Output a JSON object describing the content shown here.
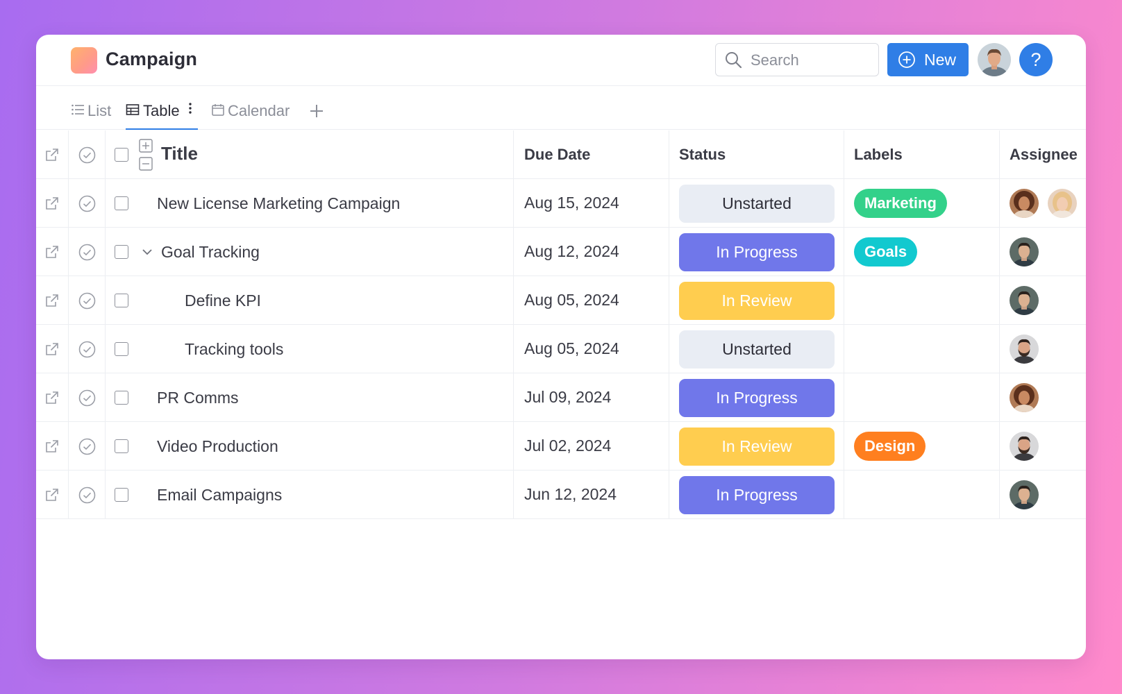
{
  "app": {
    "title": "Campaign"
  },
  "header": {
    "search": {
      "placeholder": "Search"
    },
    "new_button_label": "New",
    "help_label": "?"
  },
  "tabs": [
    {
      "label": "List",
      "icon": "list-icon",
      "active": false
    },
    {
      "label": "Table",
      "icon": "table-icon",
      "active": true
    },
    {
      "label": "Calendar",
      "icon": "calendar-icon",
      "active": false
    }
  ],
  "table": {
    "columns": {
      "title": "Title",
      "due_date": "Due Date",
      "status": "Status",
      "labels": "Labels",
      "assignee": "Assignee"
    },
    "rows": [
      {
        "title": "New License Marketing Campaign",
        "due": "Aug 15, 2024",
        "status": "Unstarted",
        "label": "Marketing",
        "assignees": [
          "woman-curly-hair",
          "woman-blonde"
        ],
        "indent": 0,
        "expandable": false
      },
      {
        "title": "Goal Tracking",
        "due": "Aug 12, 2024",
        "status": "In Progress",
        "label": "Goals",
        "assignees": [
          "man-short-hair"
        ],
        "indent": 0,
        "expandable": true
      },
      {
        "title": "Define KPI",
        "due": "Aug 05, 2024",
        "status": "In Review",
        "label": "",
        "assignees": [
          "man-short-hair"
        ],
        "indent": 1,
        "expandable": false
      },
      {
        "title": "Tracking tools",
        "due": "Aug 05, 2024",
        "status": "Unstarted",
        "label": "",
        "assignees": [
          "man-beard"
        ],
        "indent": 1,
        "expandable": false
      },
      {
        "title": "PR Comms",
        "due": "Jul 09, 2024",
        "status": "In Progress",
        "label": "",
        "assignees": [
          "woman-curly-hair"
        ],
        "indent": 0,
        "expandable": false
      },
      {
        "title": "Video Production",
        "due": "Jul 02, 2024",
        "status": "In Review",
        "label": "Design",
        "assignees": [
          "man-beard"
        ],
        "indent": 0,
        "expandable": false
      },
      {
        "title": "Email Campaigns",
        "due": "Jun 12, 2024",
        "status": "In Progress",
        "label": "",
        "assignees": [
          "man-short-hair"
        ],
        "indent": 0,
        "expandable": false
      }
    ]
  },
  "colors": {
    "accent": "#2f7ee6",
    "status_unstarted_bg": "#e9edf4",
    "status_unstarted_fg": "#2d2d37",
    "status_in_progress_bg": "#7077ea",
    "status_in_review_bg": "#ffcd4f",
    "label_marketing": "#33d18a",
    "label_goals": "#12c9cf",
    "label_design": "#ff7f1f"
  }
}
